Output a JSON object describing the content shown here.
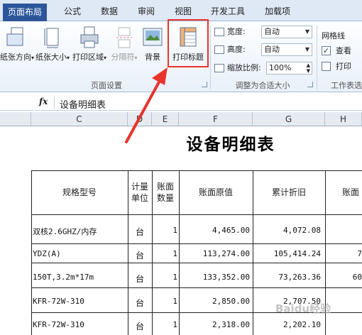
{
  "tabs": [
    "页面布局",
    "公式",
    "数据",
    "审阅",
    "视图",
    "开发工具",
    "加载项"
  ],
  "ribbon": {
    "page_setup": {
      "orientation": "纸张方向",
      "size": "纸张大小",
      "print_area": "打印区域",
      "breaks": "分隔符",
      "background": "背景",
      "print_titles": "打印标题",
      "group_label": "页面设置"
    },
    "scale_to_fit": {
      "width_label": "宽度:",
      "width_value": "自动",
      "height_label": "高度:",
      "height_value": "自动",
      "scale_label": "缩放比例:",
      "scale_value": "100%",
      "group_label": "调整为合适大小"
    },
    "sheet_options": {
      "gridlines": "网格线",
      "view": "查看",
      "print": "打印",
      "view_checked": true,
      "print_checked": false,
      "group_label": "工作表选"
    }
  },
  "formula_bar": {
    "fx": "fx",
    "value": "设备明细表"
  },
  "columns": [
    "C",
    "D",
    "E",
    "F",
    "G",
    "H"
  ],
  "sheet": {
    "title": "设备明细表",
    "headers": {
      "spec": "规格型号",
      "unit": "计量单位",
      "qty": "账面数量",
      "original": "账面原值",
      "depreciation": "累计折旧",
      "net": "账面"
    },
    "rows": [
      {
        "spec": "双核2.6GHZ/内存",
        "unit": "台",
        "qty": "1",
        "original": "4,465.00",
        "depreciation": "4,072.08",
        "net": ""
      },
      {
        "spec": "YDZ(A)",
        "unit": "台",
        "qty": "1",
        "original": "113,274.00",
        "depreciation": "105,414.24",
        "net": "7"
      },
      {
        "spec": "150T,3.2m*17m",
        "unit": "台",
        "qty": "1",
        "original": "133,352.00",
        "depreciation": "73,263.36",
        "net": "60"
      },
      {
        "spec": "KFR-72W-310",
        "unit": "台",
        "qty": "1",
        "original": "2,850.00",
        "depreciation": "2,707.50",
        "net": ""
      },
      {
        "spec": "KFR-72W-310",
        "unit": "台",
        "qty": "1",
        "original": "2,318.00",
        "depreciation": "2,202.10",
        "net": ""
      }
    ]
  },
  "watermark": "Baidu经验"
}
